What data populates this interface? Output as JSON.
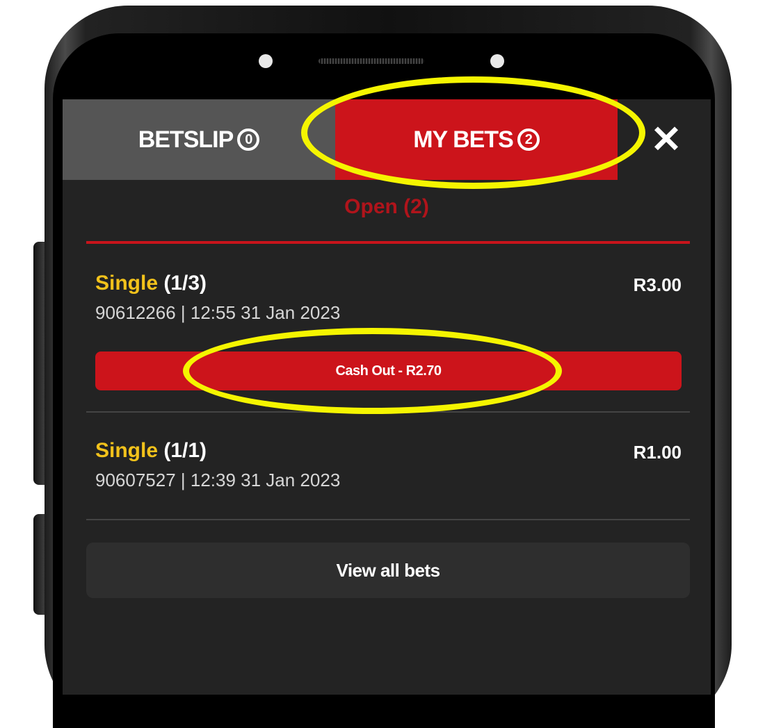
{
  "tabs": {
    "betslip_label": "BETSLIP",
    "betslip_count": "0",
    "mybets_label": "MY BETS",
    "mybets_count": "2"
  },
  "close_icon": "close-icon",
  "filter": {
    "label": "Open (2)"
  },
  "bets": [
    {
      "type": "Single",
      "count": "(1/3)",
      "amount": "R3.00",
      "meta": "90612266 | 12:55 31 Jan 2023",
      "cashout_label": "Cash Out - R2.70"
    },
    {
      "type": "Single",
      "count": "(1/1)",
      "amount": "R1.00",
      "meta": "90607527 | 12:39 31 Jan 2023"
    }
  ],
  "view_all_label": "View all bets",
  "colors": {
    "accent": "#cc141b",
    "bet_type": "#f2c21b",
    "highlight": "#f5f500",
    "background": "#232323"
  }
}
